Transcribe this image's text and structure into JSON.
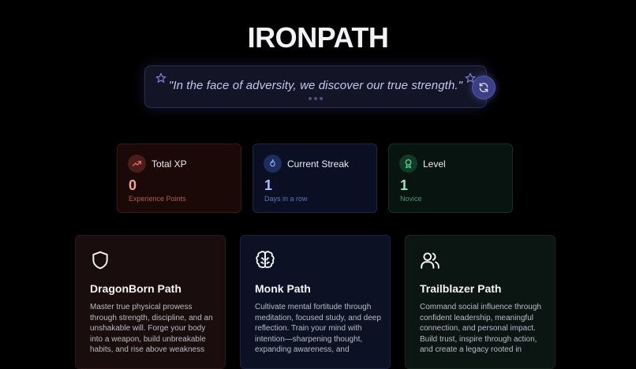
{
  "app": {
    "title": "IRONPATH"
  },
  "quote": {
    "text": "\"In the face of adversity, we discover our true strength.\"",
    "refresh_icon": "refresh-icon",
    "star_icon": "star-icon"
  },
  "stats": [
    {
      "label": "Total XP",
      "value": "0",
      "sub": "Experience Points",
      "icon": "trending-up-icon",
      "color": "#f0a79a"
    },
    {
      "label": "Current Streak",
      "value": "1",
      "sub": "Days in a row",
      "icon": "flame-icon",
      "color": "#a9c1f5"
    },
    {
      "label": "Level",
      "value": "1",
      "sub": "Novice",
      "icon": "award-icon",
      "color": "#9fe2bf"
    }
  ],
  "paths": [
    {
      "title": "DragonBorn Path",
      "icon": "shield-icon",
      "description": "Master true physical prowess through strength, discipline, and an unshakable will. Forge your body into a weapon, build unbreakable habits, and rise above weakness"
    },
    {
      "title": "Monk Path",
      "icon": "brain-icon",
      "description": "Cultivate mental fortitude through meditation, focused study, and deep reflection. Train your mind with intention—sharpening thought, expanding awareness, and"
    },
    {
      "title": "Trailblazer Path",
      "icon": "users-icon",
      "description": "Command social influence through confident leadership, meaningful connection, and personal impact. Build trust, inspire through action, and create a legacy rooted in"
    }
  ]
}
